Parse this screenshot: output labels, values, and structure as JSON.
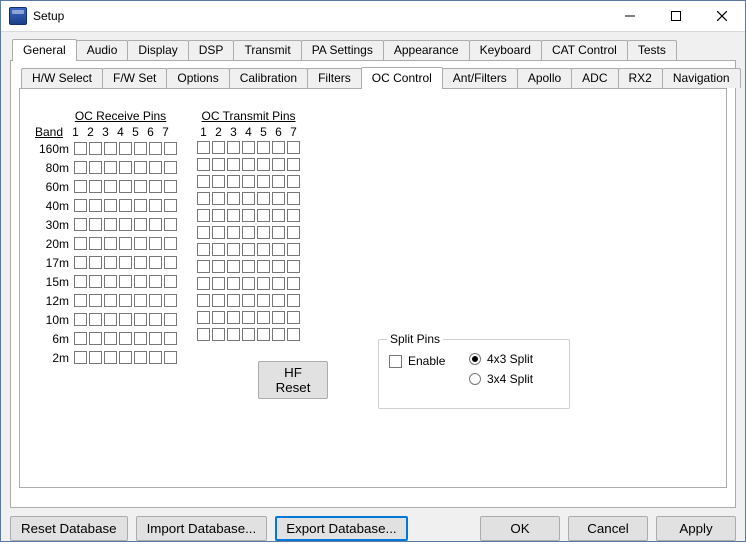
{
  "window": {
    "title": "Setup"
  },
  "tabs_outer": [
    "General",
    "Audio",
    "Display",
    "DSP",
    "Transmit",
    "PA Settings",
    "Appearance",
    "Keyboard",
    "CAT Control",
    "Tests"
  ],
  "tabs_outer_active": 0,
  "tabs_inner": [
    "H/W Select",
    "F/W Set",
    "Options",
    "Calibration",
    "Filters",
    "OC Control",
    "Ant/Filters",
    "Apollo",
    "ADC",
    "RX2",
    "Navigation"
  ],
  "tabs_inner_active": 5,
  "oc": {
    "band_header": "Band",
    "rx_title": "OC Receive Pins",
    "tx_title": "OC Transmit Pins",
    "pin_labels": [
      "1",
      "2",
      "3",
      "4",
      "5",
      "6",
      "7"
    ],
    "bands": [
      "160m",
      "80m",
      "60m",
      "40m",
      "30m",
      "20m",
      "17m",
      "15m",
      "12m",
      "10m",
      "6m",
      "2m"
    ],
    "rx": [
      [
        false,
        false,
        false,
        false,
        false,
        false,
        false
      ],
      [
        false,
        false,
        false,
        false,
        false,
        false,
        false
      ],
      [
        false,
        false,
        false,
        false,
        false,
        false,
        false
      ],
      [
        false,
        false,
        false,
        false,
        false,
        false,
        false
      ],
      [
        false,
        false,
        false,
        false,
        false,
        false,
        false
      ],
      [
        false,
        false,
        false,
        false,
        false,
        false,
        false
      ],
      [
        false,
        false,
        false,
        false,
        false,
        false,
        false
      ],
      [
        false,
        false,
        false,
        false,
        false,
        false,
        false
      ],
      [
        false,
        false,
        false,
        false,
        false,
        false,
        false
      ],
      [
        false,
        false,
        false,
        false,
        false,
        false,
        false
      ],
      [
        false,
        false,
        false,
        false,
        false,
        false,
        false
      ],
      [
        false,
        false,
        false,
        false,
        false,
        false,
        false
      ]
    ],
    "tx": [
      [
        false,
        false,
        false,
        false,
        false,
        false,
        false
      ],
      [
        false,
        false,
        false,
        false,
        false,
        false,
        false
      ],
      [
        false,
        false,
        false,
        false,
        false,
        false,
        false
      ],
      [
        false,
        false,
        false,
        false,
        false,
        false,
        false
      ],
      [
        false,
        false,
        false,
        false,
        false,
        false,
        false
      ],
      [
        false,
        false,
        false,
        false,
        false,
        false,
        false
      ],
      [
        false,
        false,
        false,
        false,
        false,
        false,
        false
      ],
      [
        false,
        false,
        false,
        false,
        false,
        false,
        false
      ],
      [
        false,
        false,
        false,
        false,
        false,
        false,
        false
      ],
      [
        false,
        false,
        false,
        false,
        false,
        false,
        false
      ],
      [
        false,
        false,
        false,
        false,
        false,
        false,
        false
      ],
      [
        false,
        false,
        false,
        false,
        false,
        false,
        false
      ]
    ]
  },
  "hf_reset_label": "HF Reset",
  "split_pins": {
    "legend": "Split Pins",
    "enable_label": "Enable",
    "enable_checked": false,
    "opts": [
      {
        "label": "4x3 Split",
        "checked": true
      },
      {
        "label": "3x4 Split",
        "checked": false
      }
    ]
  },
  "buttons": {
    "reset_db": "Reset Database",
    "import_db": "Import Database...",
    "export_db": "Export Database...",
    "ok": "OK",
    "cancel": "Cancel",
    "apply": "Apply"
  }
}
